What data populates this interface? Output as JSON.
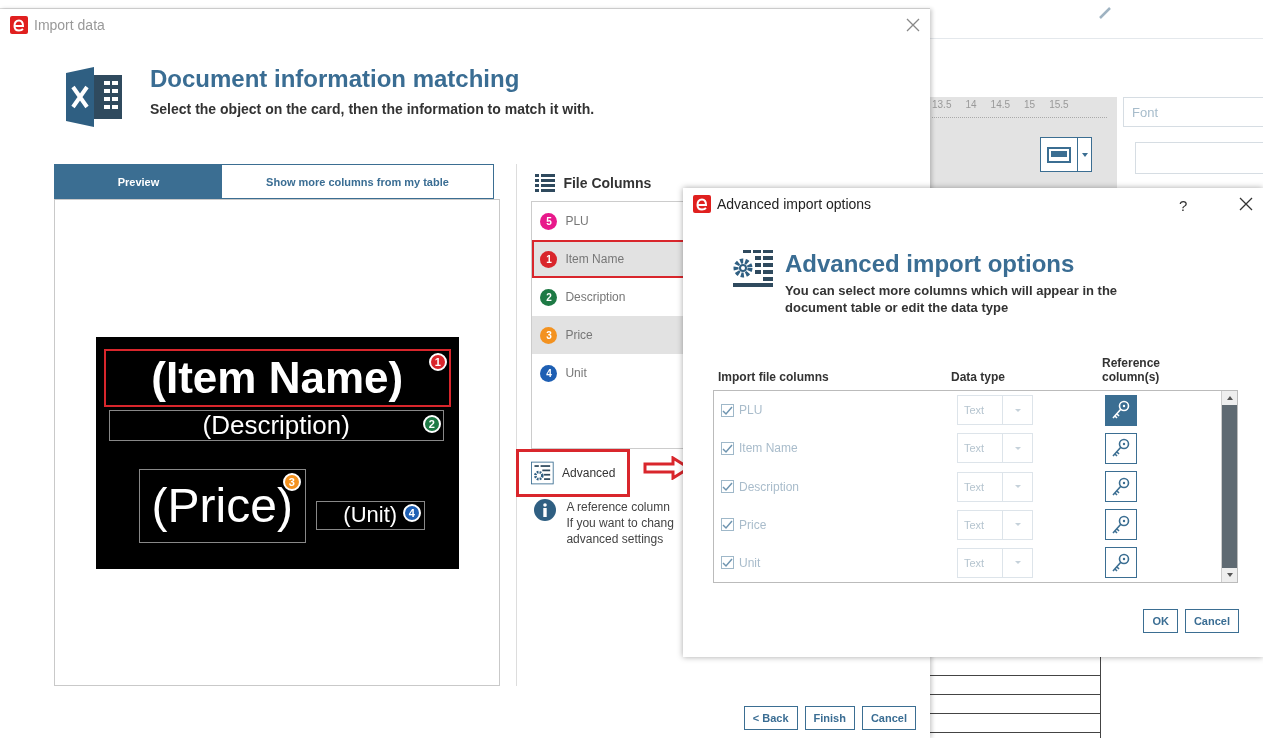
{
  "background_app": {
    "ruler_labels": [
      "13.5",
      "14",
      "14.5",
      "15",
      "15.5"
    ],
    "font_field": {
      "placeholder": "Font"
    }
  },
  "main_dialog": {
    "title": "Import data",
    "heading": "Document information matching",
    "subheading": "Select the object on the card, then the information to match it with.",
    "tabs": [
      {
        "label": "Preview",
        "selected": true
      },
      {
        "label": "Show more columns from my table",
        "selected": false
      }
    ],
    "card_fields": [
      {
        "kind": "title",
        "text": "(Item Name)",
        "badge": "1",
        "color": "#d9262c",
        "highlighted": true
      },
      {
        "kind": "subtitle",
        "text": "(Description)",
        "badge": "2",
        "color": "#1e7a45",
        "highlighted": false
      },
      {
        "kind": "price",
        "text": "(Price)",
        "badge": "3",
        "color": "#f39220",
        "highlighted": false
      },
      {
        "kind": "unit",
        "text": "(Unit)",
        "badge": "4",
        "color": "#1e5fb3",
        "highlighted": false
      }
    ],
    "file_columns_title": "File Columns",
    "file_columns": [
      {
        "badge": "5",
        "label": "PLU",
        "color": "#e8198b",
        "selected": false,
        "highlighted": false
      },
      {
        "badge": "1",
        "label": "Item Name",
        "color": "#d9262c",
        "selected": true,
        "highlighted": true
      },
      {
        "badge": "2",
        "label": "Description",
        "color": "#1e7a45",
        "selected": false,
        "highlighted": false
      },
      {
        "badge": "3",
        "label": "Price",
        "color": "#f39220",
        "selected": true,
        "highlighted": false
      },
      {
        "badge": "4",
        "label": "Unit",
        "color": "#1e5fb3",
        "selected": false,
        "highlighted": false
      }
    ],
    "advanced_button": {
      "label": "Advanced",
      "highlighted": true
    },
    "info_lines": [
      "A reference column",
      "If you want to chang",
      "advanced settings"
    ],
    "buttons": [
      "< Back",
      "Finish",
      "Cancel"
    ]
  },
  "advanced_dialog": {
    "title": "Advanced import options",
    "help": "?",
    "heading": "Advanced import options",
    "subheading": "You can select more columns which will appear in the document table or edit the data type",
    "columns": [
      "Import file columns",
      "Data type",
      "Reference column(s)"
    ],
    "rows": [
      {
        "label": "PLU",
        "checked": true,
        "data_type": "Text",
        "reference": true
      },
      {
        "label": "Item Name",
        "checked": true,
        "data_type": "Text",
        "reference": false
      },
      {
        "label": "Description",
        "checked": true,
        "data_type": "Text",
        "reference": false
      },
      {
        "label": "Price",
        "checked": true,
        "data_type": "Text",
        "reference": false
      },
      {
        "label": "Unit",
        "checked": true,
        "data_type": "Text",
        "reference": false
      }
    ],
    "buttons": [
      "OK",
      "Cancel"
    ]
  }
}
